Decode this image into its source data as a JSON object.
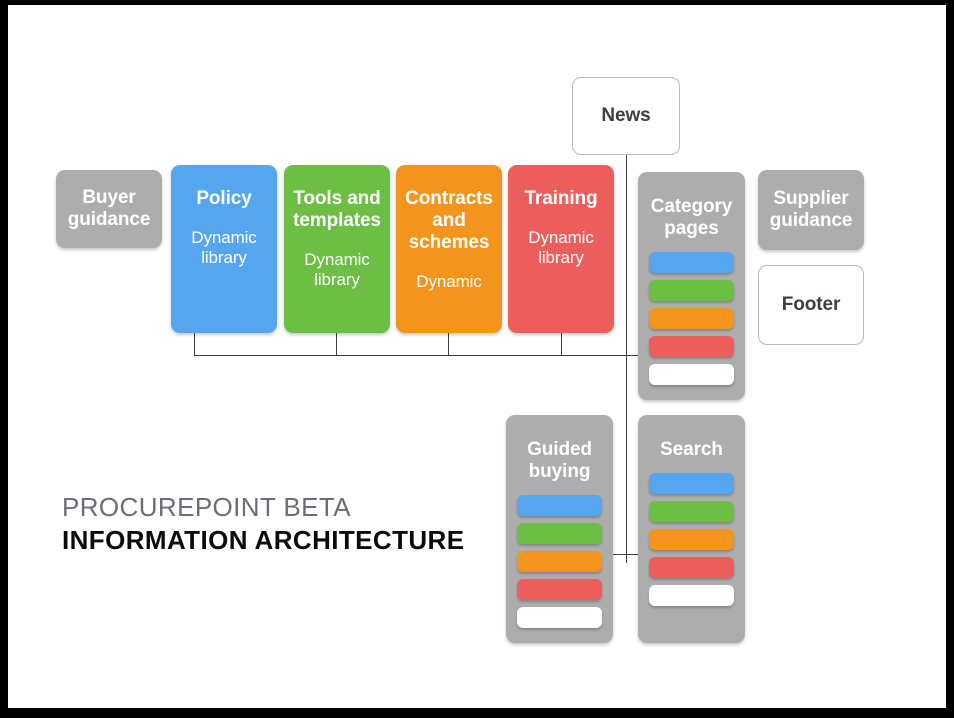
{
  "diagram": {
    "heading": {
      "line1": "PROCUREPOINT BETA",
      "line2": "INFORMATION ARCHITECTURE"
    },
    "colors": {
      "blue": "#55a5ef",
      "green": "#6dbe45",
      "orange": "#f3941d",
      "red": "#ec5e5c",
      "grey": "#adadad",
      "white": "#ffffff",
      "line": "#3f3f3f",
      "heading_muted": "#6b6f75",
      "heading_dark": "#0b0b0b"
    },
    "nodes": {
      "buyer_guidance": {
        "title": "Buyer guidance",
        "sub": ""
      },
      "policy": {
        "title": "Policy",
        "sub": "Dynamic library"
      },
      "tools": {
        "title": "Tools and templates",
        "sub": "Dynamic library"
      },
      "contracts": {
        "title": "Contracts and schemes",
        "sub": "Dynamic"
      },
      "training": {
        "title": "Training",
        "sub": "Dynamic library"
      },
      "news": {
        "title": "News"
      },
      "category_pages": {
        "title": "Category pages"
      },
      "supplier_guidance": {
        "title": "Supplier guidance"
      },
      "footer": {
        "title": "Footer"
      },
      "guided_buying": {
        "title": "Guided buying"
      },
      "search": {
        "title": "Search"
      }
    },
    "stack_bars": [
      "blue",
      "green",
      "orange",
      "red",
      "white"
    ]
  }
}
